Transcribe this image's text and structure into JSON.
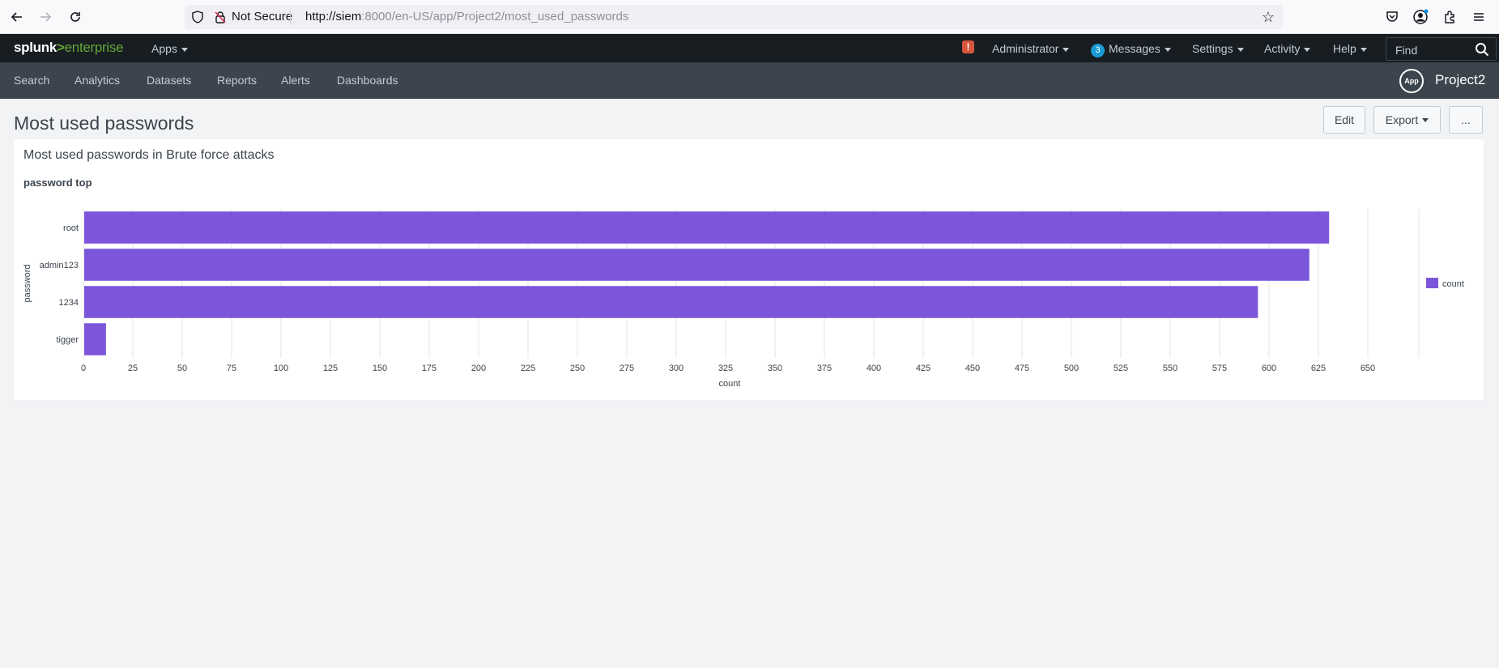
{
  "browser": {
    "security_label": "Not Secure",
    "url_host": "http://siem",
    "url_rest": ":8000/en-US/app/Project2/most_used_passwords"
  },
  "splunk": {
    "logo_brand": "splunk",
    "logo_gt": ">",
    "logo_product": "enterprise",
    "apps_label": "Apps",
    "user_label": "Administrator",
    "messages_count": "3",
    "messages_label": "Messages",
    "settings_label": "Settings",
    "activity_label": "Activity",
    "help_label": "Help",
    "find_placeholder": "Find",
    "alert_glyph": "!"
  },
  "app_nav": {
    "items": [
      "Search",
      "Analytics",
      "Datasets",
      "Reports",
      "Alerts",
      "Dashboards"
    ],
    "badge": "App",
    "app_name": "Project2"
  },
  "page": {
    "title": "Most used passwords",
    "edit_label": "Edit",
    "export_label": "Export",
    "more_label": "..."
  },
  "panel": {
    "title": "Most used passwords in Brute force attacks",
    "viz_title": "password top"
  },
  "colors": {
    "bar": "#7b56db",
    "grid": "#e1e6eb"
  },
  "chart_data": {
    "type": "bar",
    "orientation": "horizontal",
    "categories": [
      "root",
      "admin123",
      "1234",
      "tigger"
    ],
    "series": [
      {
        "name": "count",
        "values": [
          630,
          620,
          594,
          11
        ]
      }
    ],
    "xlabel": "count",
    "ylabel": "password",
    "xlim": [
      0,
      675
    ],
    "xticks": [
      0,
      25,
      50,
      75,
      100,
      125,
      150,
      175,
      200,
      225,
      250,
      275,
      300,
      325,
      350,
      375,
      400,
      425,
      450,
      475,
      500,
      525,
      550,
      575,
      600,
      625,
      650
    ],
    "grid": true,
    "legend": "right"
  }
}
